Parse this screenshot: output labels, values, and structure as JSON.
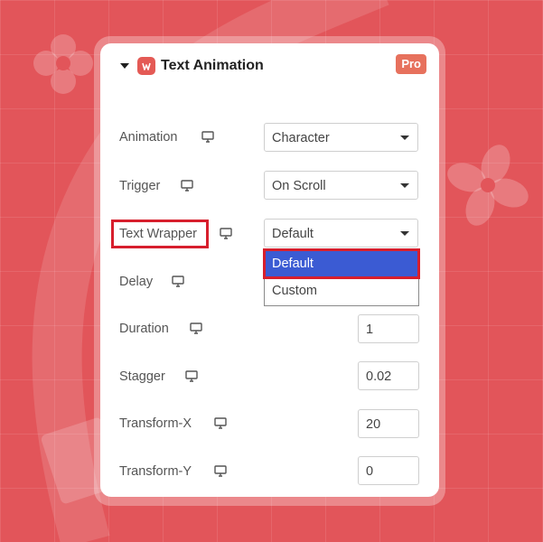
{
  "colors": {
    "background": "#e2555a",
    "accent_red": "#d71f2d",
    "pro_badge": "#e7715d",
    "selected_option": "#3b5bd3"
  },
  "header": {
    "title": "Text Animation",
    "badge": "Pro",
    "icons": [
      "caret-down-icon",
      "plugin-logo-icon"
    ]
  },
  "fields": [
    {
      "label": "Animation",
      "type": "select",
      "value": "Character"
    },
    {
      "label": "Trigger",
      "type": "select",
      "value": "On Scroll"
    },
    {
      "label": "Text Wrapper",
      "type": "select",
      "value": "Default",
      "highlighted": true
    },
    {
      "label": "Delay",
      "type": "number",
      "value": ""
    },
    {
      "label": "Duration",
      "type": "number",
      "value": "1"
    },
    {
      "label": "Stagger",
      "type": "number",
      "value": "0.02"
    },
    {
      "label": "Transform-X",
      "type": "number",
      "value": "20"
    },
    {
      "label": "Transform-Y",
      "type": "number",
      "value": "0"
    }
  ],
  "text_wrapper_dropdown": {
    "options": [
      "Default",
      "Custom"
    ],
    "selected": "Default"
  },
  "responsive_icon": "desktop-monitor-icon"
}
